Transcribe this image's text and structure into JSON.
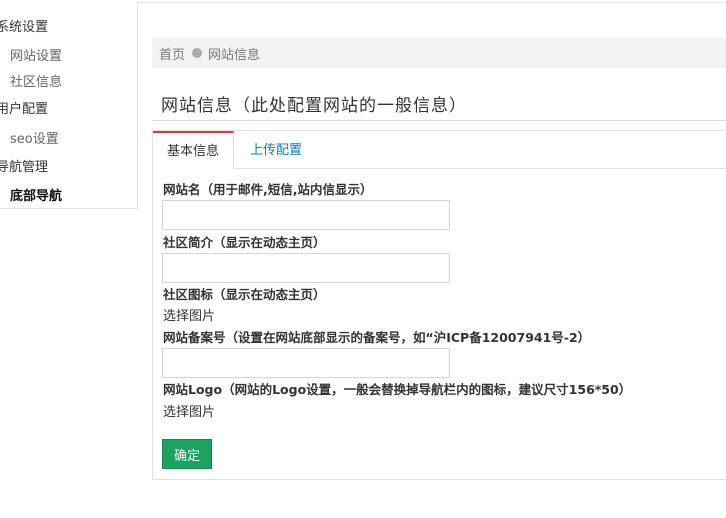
{
  "sidebar": {
    "groups": [
      {
        "label": "系统设置",
        "items": [
          {
            "label": "网站设置"
          },
          {
            "label": "社区信息"
          }
        ]
      },
      {
        "label": "用户配置",
        "items": [
          {
            "label": "seo设置"
          }
        ]
      },
      {
        "label": "导航管理",
        "items": [
          {
            "label": "底部导航"
          }
        ]
      }
    ]
  },
  "breadcrumb": {
    "home": "首页",
    "current": "网站信息"
  },
  "page": {
    "title": "网站信息（此处配置网站的一般信息）"
  },
  "tabs": [
    {
      "label": "基本信息",
      "active": true
    },
    {
      "label": "上传配置",
      "active": false
    }
  ],
  "form": {
    "site_name": {
      "label": "网站名（用于邮件,短信,站内信显示）",
      "value": ""
    },
    "community_intro": {
      "label": "社区简介（显示在动态主页）",
      "value": ""
    },
    "community_icon": {
      "label": "社区图标（显示在动态主页）",
      "action": "选择图片"
    },
    "icp": {
      "label": "网站备案号（设置在网站底部显示的备案号，如“沪ICP备12007941号-2）",
      "value": ""
    },
    "logo": {
      "label": "网站Logo（网站的Logo设置，一般会替换掉导航栏内的图标，建议尺寸156*50）",
      "action": "选择图片"
    },
    "submit_label": "确定"
  },
  "colors": {
    "accent_tab": "#e4393c",
    "link": "#0e7ac4",
    "submit": "#1aa260"
  }
}
